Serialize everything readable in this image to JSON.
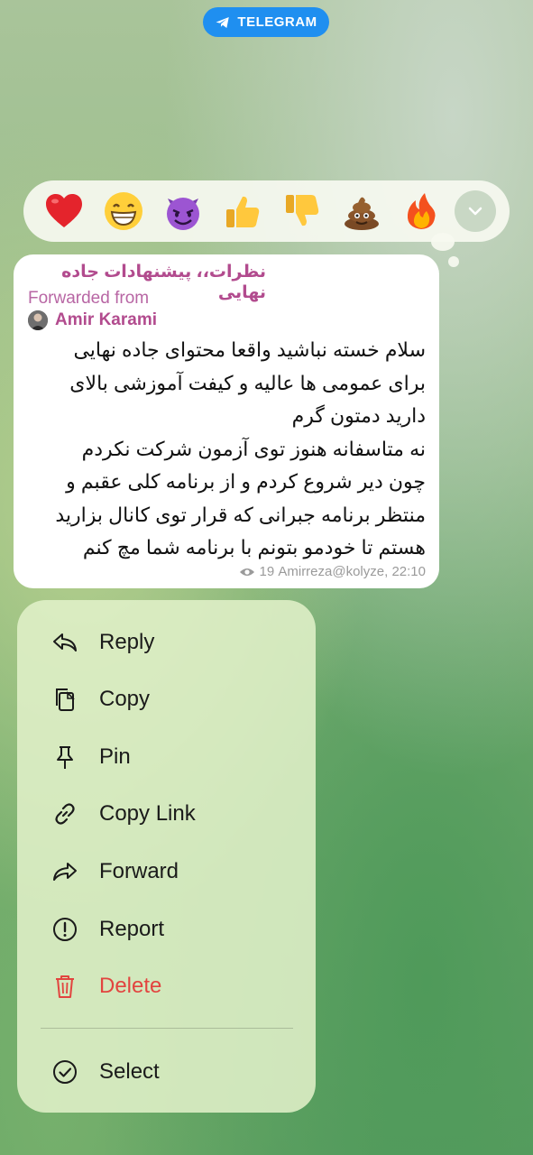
{
  "app_badge": "TELEGRAM",
  "reactions": [
    {
      "icon": "red-heart-icon"
    },
    {
      "icon": "grinning-face-icon"
    },
    {
      "icon": "smiling-devil-icon"
    },
    {
      "icon": "thumbs-up-icon"
    },
    {
      "icon": "thumbs-down-icon"
    },
    {
      "icon": "pile-of-poo-icon"
    },
    {
      "icon": "fire-icon"
    }
  ],
  "message": {
    "channel": "نظرات،، پیشنهادات جاده نهایی",
    "forwarded_label": "Forwarded from",
    "forwarded_name": "Amir Karami",
    "lines": [
      "سلام خسته نباشید واقعا محتوای جاده نهایی",
      "برای عمومی ها عالیه و کیفت آموزشی بالای",
      "دارید دمتون گرم",
      "نه متاسفانه هنوز توی آزمون شرکت نکردم",
      "چون دیر شروع کردم و از برنامه کلی عقبم و",
      "منتظر برنامه جبرانی که قرار توی کانال بزارید",
      "هستم تا خودمو بتونم با برنامه شما مچ کنم"
    ],
    "views": "19",
    "author": "Amirreza@kolyze,",
    "time": "22:10"
  },
  "menu": {
    "reply": "Reply",
    "copy": "Copy",
    "pin": "Pin",
    "copy_link": "Copy Link",
    "forward": "Forward",
    "report": "Report",
    "delete": "Delete",
    "select": "Select"
  },
  "colors": {
    "accent_blue": "#1f8ff0",
    "forward_pink": "#b24b8e",
    "danger_red": "#e2443f"
  }
}
